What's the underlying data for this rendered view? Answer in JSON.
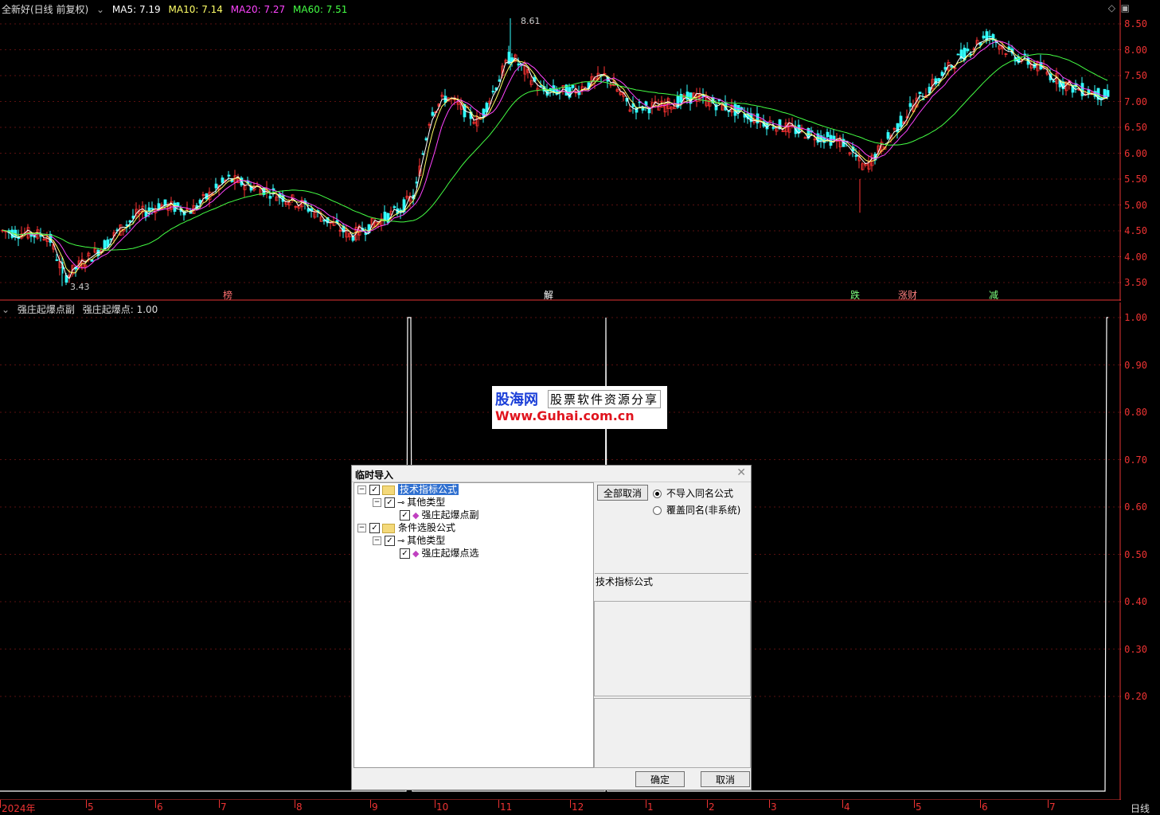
{
  "price_header": {
    "title": "全新好(日线 前复权)",
    "ma5": "MA5: 7.19",
    "ma10": "MA10: 7.14",
    "ma20": "MA20: 7.27",
    "ma60": "MA60: 7.51"
  },
  "indicator_header": {
    "name": "强庄起爆点副",
    "value": "强庄起爆点: 1.00"
  },
  "price_axis": [
    "8.50",
    "8.00",
    "7.50",
    "7.00",
    "6.50",
    "6.00",
    "5.50",
    "5.00",
    "4.50",
    "4.00",
    "3.50"
  ],
  "indicator_axis": [
    "1.00",
    "0.90",
    "0.80",
    "0.70",
    "0.60",
    "0.50",
    "0.40",
    "0.30",
    "0.20"
  ],
  "annotations": {
    "high": "8.61",
    "low": "3.43"
  },
  "event_tags": [
    {
      "text": "榜",
      "color": "#ff7070"
    },
    {
      "text": "解",
      "color": "#ffffff"
    },
    {
      "text": "跌",
      "color": "#7fff7f"
    },
    {
      "text": "涨财",
      "color": "#ff8080"
    },
    {
      "text": "减",
      "color": "#7fff7f"
    }
  ],
  "date_axis": [
    "2024年",
    "5",
    "6",
    "7",
    "8",
    "9",
    "10",
    "11",
    "12",
    "1",
    "2",
    "3",
    "4",
    "5",
    "6",
    "7"
  ],
  "period_label": "日线",
  "colors": {
    "ma5": "#ffffff",
    "ma10": "#ffff66",
    "ma20": "#ff44ff",
    "ma60": "#44ff44",
    "up": "#ff3333",
    "down": "#33ffff",
    "axis": "#e33333"
  },
  "watermark": {
    "brand": "股海网",
    "slogan": "股票软件资源分享",
    "url": "Www.Guhai.com.cn"
  },
  "dialog": {
    "title": "临时导入",
    "tree": [
      {
        "label": "技术指标公式",
        "level": 0,
        "checked": true,
        "selected": true,
        "icon": "folder-icon"
      },
      {
        "label": "其他类型",
        "level": 1,
        "checked": true,
        "icon": "key-icon"
      },
      {
        "label": "强庄起爆点副",
        "level": 2,
        "checked": true,
        "icon": "formula-icon"
      },
      {
        "label": "条件选股公式",
        "level": 0,
        "checked": true,
        "icon": "folder-icon"
      },
      {
        "label": "其他类型",
        "level": 1,
        "checked": true,
        "icon": "key-icon"
      },
      {
        "label": "强庄起爆点选",
        "level": 2,
        "checked": true,
        "icon": "formula-icon"
      }
    ],
    "cancel_all": "全部取消",
    "radio_options": [
      {
        "label": "不导入同名公式",
        "checked": true
      },
      {
        "label": "覆盖同名(非系统)",
        "checked": false
      }
    ],
    "info_label": "技术指标公式",
    "ok": "确定",
    "cancel": "取消"
  }
}
